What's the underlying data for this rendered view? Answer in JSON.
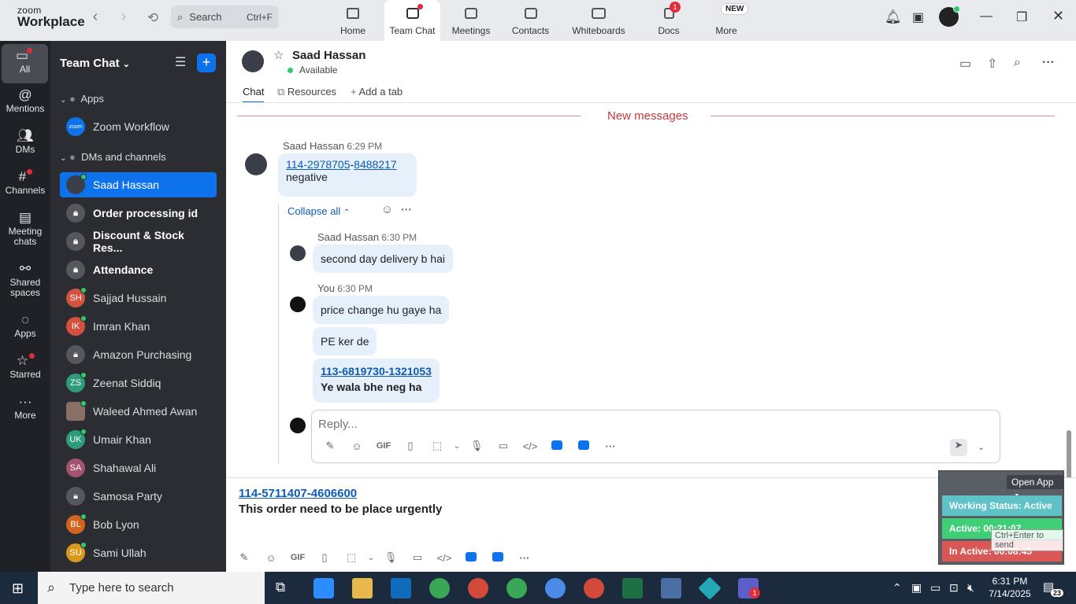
{
  "app": {
    "logo_top": "zoom",
    "logo_bottom": "Workplace"
  },
  "search": {
    "label": "Search",
    "shortcut": "Ctrl+F"
  },
  "top_tabs": [
    {
      "label": "Home"
    },
    {
      "label": "Team Chat"
    },
    {
      "label": "Meetings"
    },
    {
      "label": "Contacts"
    },
    {
      "label": "Whiteboards"
    },
    {
      "label": "Docs",
      "badge": "1"
    },
    {
      "label": "More",
      "badge": "NEW"
    }
  ],
  "rail": [
    {
      "label": "All"
    },
    {
      "label": "Mentions"
    },
    {
      "label": "DMs"
    },
    {
      "label": "Channels"
    },
    {
      "label": "Meeting chats"
    },
    {
      "label": "Shared spaces"
    },
    {
      "label": "Apps"
    },
    {
      "label": "Starred"
    },
    {
      "label": "More"
    }
  ],
  "sidebar": {
    "title": "Team Chat",
    "sections": {
      "apps": "Apps",
      "dms": "DMs and channels"
    },
    "items": [
      {
        "label": "Zoom Workflow",
        "avatar": "zoom"
      },
      {
        "label": "Saad Hassan"
      },
      {
        "label": "Order processing id"
      },
      {
        "label": "Discount & Stock Res..."
      },
      {
        "label": "Attendance"
      },
      {
        "label": "Sajjad Hussain",
        "initials": "SH"
      },
      {
        "label": "Imran Khan",
        "initials": "IK"
      },
      {
        "label": "Amazon Purchasing"
      },
      {
        "label": "Zeenat Siddiq",
        "initials": "ZS"
      },
      {
        "label": "Waleed Ahmed Awan"
      },
      {
        "label": "Umair Khan",
        "initials": "UK"
      },
      {
        "label": "Shahawal Ali",
        "initials": "SA"
      },
      {
        "label": "Samosa Party"
      },
      {
        "label": "Bob Lyon",
        "initials": "BL"
      },
      {
        "label": "Sami Ullah",
        "initials": "SU"
      }
    ]
  },
  "chat_header": {
    "name": "Saad Hassan",
    "status": "Available",
    "tabs": [
      "Chat",
      "Resources",
      "Add a tab"
    ]
  },
  "messages": {
    "new_messages": "New messages",
    "m1": {
      "sender": "Saad Hassan",
      "time": "6:29 PM",
      "link_a": "114-2978705",
      "sep": "-",
      "link_b": "8488217",
      "text": "negative"
    },
    "collapse": "Collapse all",
    "m2": {
      "sender": "Saad Hassan",
      "time": "6:30 PM",
      "text": "second day delivery b hai"
    },
    "m3": {
      "sender": "You",
      "time": "6:30 PM",
      "text1": "price change hu gaye ha",
      "text2": "PE ker de",
      "link": "113-6819730-1321053",
      "text3": "Ye wala bhe neg ha"
    }
  },
  "reply": {
    "placeholder": "Reply..."
  },
  "toolbar": {
    "gif": "GIF"
  },
  "composer": {
    "link": "114-5711407-4606600",
    "text": "This order need to be place urgently"
  },
  "status_widget": {
    "open_app": "Open App ↗",
    "working": "Working Status: Active",
    "active": "Active: 00:21:07",
    "inactive": "In Active: 00:08:45",
    "tooltip": "Ctrl+Enter to send"
  },
  "taskbar": {
    "search": "Type here to search",
    "time": "6:31 PM",
    "date": "7/14/2025",
    "notif": "23",
    "teams_badge": "1"
  },
  "colors": {
    "accent": "#0e72ed",
    "sidebar_bg": "#2b2d33",
    "rail_bg": "#1f2127",
    "working": "#5ec2c7",
    "active": "#3fcf77",
    "inactive": "#d95757"
  }
}
